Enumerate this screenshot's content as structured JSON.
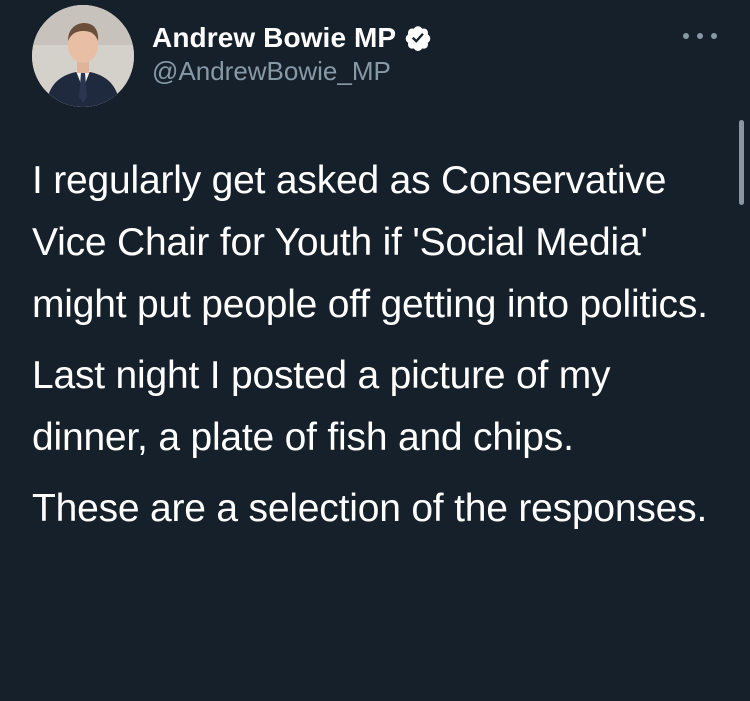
{
  "author": {
    "display_name": "Andrew Bowie MP",
    "handle": "@AndrewBowie_MP",
    "verified": true,
    "avatar_icon": "profile-photo"
  },
  "menu": {
    "icon": "more-horizontal-icon"
  },
  "tweet": {
    "paragraphs": [
      "I regularly get asked as Conservative Vice Chair for Youth if 'Social Media' might put people off getting into politics.",
      "Last night I posted a picture of my dinner, a plate of fish and chips.",
      "These are a selection of the responses."
    ]
  },
  "colors": {
    "background": "#15202b",
    "primary_text": "#ffffff",
    "secondary_text": "#8899a6",
    "verified_badge": "#ffffff"
  }
}
